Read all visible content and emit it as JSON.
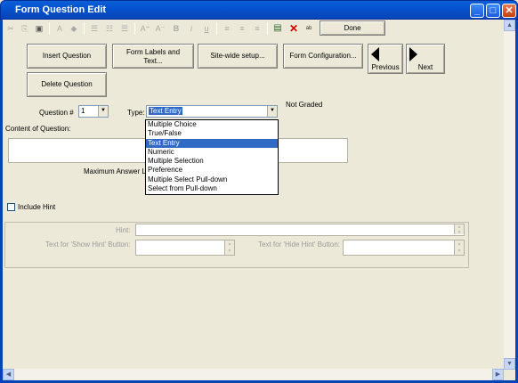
{
  "window": {
    "title": "Form Question Edit",
    "min_label": "_",
    "max_label": "□",
    "close_label": "✕"
  },
  "toolbar": {
    "done_label": "Done",
    "icons": [
      "scissors-icon",
      "copy-icon",
      "paste-icon",
      "font-icon",
      "color-icon",
      "bullet-list-icon",
      "numbered-list-icon",
      "indent-icon",
      "superscript-icon",
      "subscript-icon",
      "bold-icon",
      "italic-icon",
      "underline-icon",
      "align-left-icon",
      "align-center-icon",
      "align-right-icon",
      "save-icon",
      "delete-icon",
      "spellcheck-icon"
    ],
    "glyphs": {
      "scissors": "✂",
      "copy": "⎘",
      "paste": "▣",
      "font": "A",
      "color": "◆",
      "bullets": "☰",
      "numbered": "☷",
      "indent": "☰",
      "superscript": "A⁺",
      "subscript": "A⁻",
      "bold": "B",
      "italic": "i",
      "underline": "u",
      "align_left": "≡",
      "align_center": "≡",
      "align_right": "≡",
      "save": "▤",
      "delete": "✕",
      "spell": "ᵃᵇ"
    }
  },
  "buttons": {
    "insert": "Insert Question",
    "labels_line1": "Form Labels and",
    "labels_line2": "Text...",
    "sitewide": "Site-wide setup...",
    "config": "Form Configuration...",
    "previous": "Previous",
    "next": "Next",
    "delete": "Delete Question"
  },
  "question": {
    "number_label": "Question #",
    "number_value": "1",
    "type_label": "Type:",
    "type_value": "Text Entry",
    "graded_status": "Not Graded",
    "content_label": "Content of Question:",
    "max_answer_label": "Maximum Answer L"
  },
  "type_options": [
    "Multiple Choice",
    "True/False",
    "Text Entry",
    "Numeric",
    "Multiple Selection",
    "Preference",
    "Multiple Select Pull-down",
    "Select from Pull-down"
  ],
  "selected_option_index": 2,
  "hint": {
    "include_label": "Include Hint",
    "hint_label": "Hint:",
    "show_label": "Text for 'Show Hint' Button:",
    "hide_label": "Text for 'Hide Hint' Button:"
  },
  "colors": {
    "titlebar": "#0553d0",
    "background": "#ece9d8",
    "selection": "#316ac5"
  }
}
